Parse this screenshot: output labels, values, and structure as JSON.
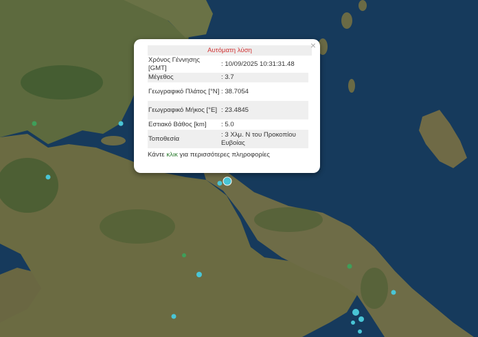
{
  "popup": {
    "title": "Αυτόματη λύση",
    "close_label": "×",
    "rows": [
      {
        "key": "Χρόνος Γέννησης [GMT]",
        "value": ": 10/09/2025 10:31:31.48"
      },
      {
        "key": "Μέγεθος",
        "value": ": 3.7"
      },
      {
        "key": "Γεωγραφικό Πλάτος [°N]",
        "value": ": 38.7054"
      },
      {
        "key": "Γεωγραφικό Μήκος [°E]",
        "value": ": 23.4845"
      },
      {
        "key": "Εστιακό Βάθος [km]",
        "value": ": 5.0"
      },
      {
        "key": "Τοποθεσία",
        "value": ": 3 Χλμ. Ν του Προκοπίου Ευβοίας"
      }
    ],
    "more_prefix": "Κάντε ",
    "more_link": "κλικ",
    "more_suffix": " για περισσότερες πληροφορίες"
  },
  "map": {
    "colors": {
      "sea": "#163a5c",
      "land": "#5a6a3c",
      "forest": "#3f5a2e",
      "quake_marker": "#49c5d6",
      "old_quake_marker": "#3f9e5a"
    }
  }
}
